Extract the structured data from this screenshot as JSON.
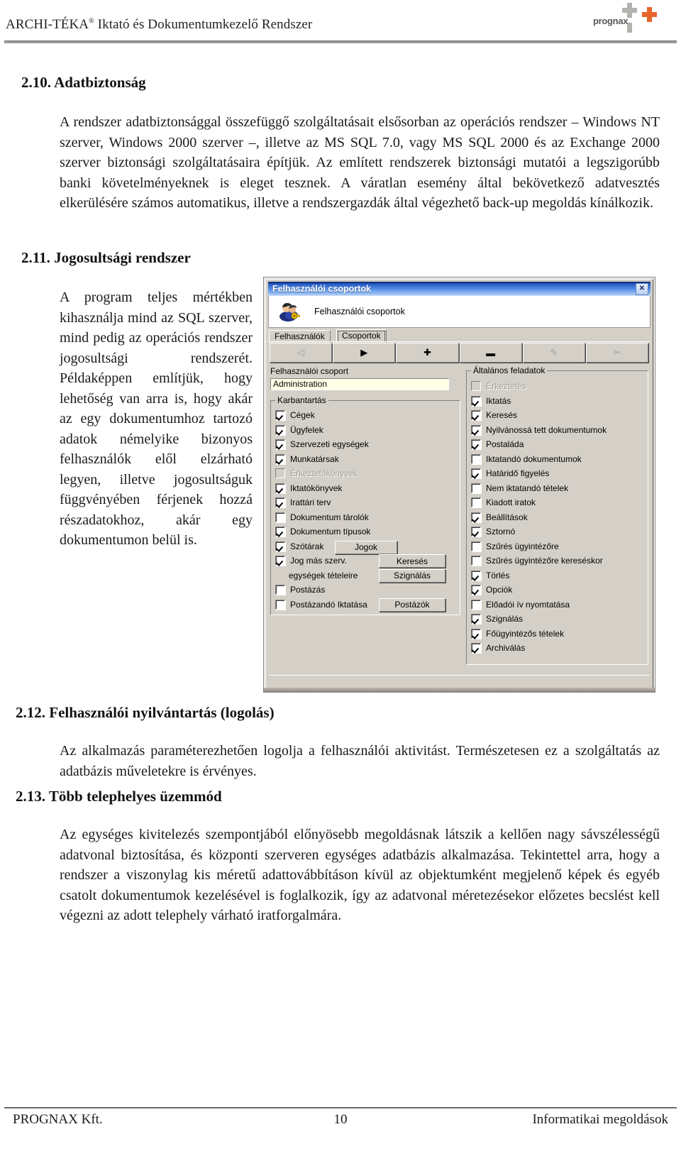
{
  "header": {
    "title_main": "ARCHI-TÉKA",
    "title_reg": "®",
    "title_rest": " Iktató és Dokumentumkezelő Rendszer",
    "logo_word": "prognax"
  },
  "sections": {
    "s210": {
      "number": "2.10.",
      "heading": "Adatbiztonság",
      "body": "A rendszer adatbiztonsággal összefüggő szolgáltatásait elsősorban az operációs rendszer – Windows NT szerver, Windows 2000 szerver –, illetve az MS SQL 7.0, vagy MS SQL 2000 és az Exchange 2000 szerver biztonsági szolgáltatásaira építjük. Az említett rendszerek biztonsági mutatói a legszigorúbb banki követelményeknek is eleget tesznek. A váratlan esemény által bekövetkező adatvesztés elkerülésére számos automatikus, illetve a rendszergazdák által végezhető back-up megoldás kínálkozik."
    },
    "s211": {
      "number": "2.11.",
      "heading": "Jogosultsági rendszer",
      "body": "A program teljes mértékben kihasználja mind az SQL szerver, mind pedig az operációs rendszer jogosultsági rendszerét. Példaképpen említjük, hogy lehetőség van arra is, hogy akár az egy dokumentumhoz tartozó adatok némelyike bizonyos felhasználók elől elzárható legyen, illetve jogosultságuk függvényében férjenek hozzá részadatokhoz, akár egy dokumentumon belül is."
    },
    "s212": {
      "number": "2.12.",
      "heading": "Felhasználói nyilvántartás (logolás)",
      "body": "Az alkalmazás paraméterezhetően logolja a felhasználói aktivitást. Természetesen ez a szolgáltatás az adatbázis műveletekre is érvényes."
    },
    "s213": {
      "number": "2.13.",
      "heading": "Több telephelyes üzemmód",
      "body": "Az egységes kivitelezés szempontjából előnyösebb megoldásnak látszik a kellően nagy sávszélességű adatvonal biztosítása, és központi szerveren egységes adatbázis alkalmazása. Tekintettel arra, hogy a rendszer a viszonylag kis méretű adattovábbításon kívül az objektumként megjelenő képek és egyéb csatolt dokumentumok kezelésével is foglalkozik, így az adatvonal méretezésekor előzetes becslést kell végezni az adott telephely várható iratforgalmára."
    }
  },
  "footer": {
    "left": "PROGNAX Kft.",
    "page_number": "10",
    "right": "Informatikai megoldások"
  },
  "dialog": {
    "title": "Felhasználói csoportok",
    "close_glyph": "✕",
    "banner_text": "Felhasználói csoportok",
    "tabs": [
      {
        "label": "Felhasználók",
        "active": false
      },
      {
        "label": "Csoportok",
        "active": true
      }
    ],
    "toolbar_buttons": [
      {
        "name": "first-record-button",
        "glyph": "◁",
        "disabled": true
      },
      {
        "name": "next-record-button",
        "glyph": "▶",
        "disabled": false
      },
      {
        "name": "add-record-button",
        "glyph": "✚",
        "disabled": false
      },
      {
        "name": "delete-record-button",
        "glyph": "▬",
        "disabled": false
      },
      {
        "name": "edit-record-button",
        "glyph": "✎",
        "disabled": true
      },
      {
        "name": "cancel-edit-button",
        "glyph": "✂",
        "disabled": true
      }
    ],
    "group_field": {
      "label": "Felhasználói csoport",
      "value": "Administration"
    },
    "left_group": {
      "title": "Karbantartás",
      "items": [
        {
          "label": "Cégek",
          "checked": true,
          "disabled": false
        },
        {
          "label": "Ügyfelek",
          "checked": true,
          "disabled": false
        },
        {
          "label": "Szervezeti egységek",
          "checked": true,
          "disabled": false
        },
        {
          "label": "Munkatársak",
          "checked": true,
          "disabled": false
        },
        {
          "label": "Érkeztetőkönyvek",
          "checked": false,
          "disabled": true
        },
        {
          "label": "Iktatókönyvek",
          "checked": true,
          "disabled": false
        },
        {
          "label": "Irattári terv",
          "checked": true,
          "disabled": false
        },
        {
          "label": "Dokumentum tárolók",
          "checked": false,
          "disabled": false
        },
        {
          "label": "Dokumentum típusok",
          "checked": true,
          "disabled": false
        },
        {
          "label": "Szótárak",
          "checked": true,
          "disabled": false
        },
        {
          "label": "Jog más szerv.",
          "checked": true,
          "disabled": false
        },
        {
          "label": "egységek tételeire",
          "checked": null,
          "disabled": false
        },
        {
          "label": "Postázás",
          "checked": false,
          "disabled": false
        },
        {
          "label": "Postázandó Iktatása",
          "checked": false,
          "disabled": false
        }
      ],
      "buttons": {
        "jogok": "Jogok",
        "kereses": "Keresés",
        "szignalas": "Szignálás",
        "postazok": "Postázók"
      }
    },
    "right_group": {
      "title": "Általános feladatok",
      "items": [
        {
          "label": "Érkeztetés",
          "checked": false,
          "disabled": true
        },
        {
          "label": "Iktatás",
          "checked": true,
          "disabled": false
        },
        {
          "label": "Keresés",
          "checked": true,
          "disabled": false
        },
        {
          "label": "Nyilvánossá tett dokumentumok",
          "checked": true,
          "disabled": false
        },
        {
          "label": "Postaláda",
          "checked": true,
          "disabled": false
        },
        {
          "label": "Iktatandó dokumentumok",
          "checked": false,
          "disabled": false
        },
        {
          "label": "Határidő figyelés",
          "checked": true,
          "disabled": false
        },
        {
          "label": "Nem iktatandó tételek",
          "checked": false,
          "disabled": false
        },
        {
          "label": "Kiadott iratok",
          "checked": false,
          "disabled": false
        },
        {
          "label": "Beállítások",
          "checked": true,
          "disabled": false
        },
        {
          "label": "Sztornó",
          "checked": true,
          "disabled": false
        },
        {
          "label": "Szűrés ügyintézőre",
          "checked": false,
          "disabled": false
        },
        {
          "label": "Szűrés ügyintézőre kereséskor",
          "checked": false,
          "disabled": false
        },
        {
          "label": "Törlés",
          "checked": true,
          "disabled": false
        },
        {
          "label": "Opciók",
          "checked": true,
          "disabled": false
        },
        {
          "label": "Előadói ív nyomtatása",
          "checked": false,
          "disabled": false
        },
        {
          "label": "Szignálás",
          "checked": true,
          "disabled": false
        },
        {
          "label": "Főügyintézős tételek",
          "checked": true,
          "disabled": false
        },
        {
          "label": "Archiválás",
          "checked": true,
          "disabled": false
        }
      ]
    }
  },
  "colors": {
    "dialog_face": "#d4d0c8",
    "titlebar_blue": "#0a246a",
    "logo_orange": "#e8642a",
    "logo_gray": "#b2b2ae",
    "field_bg": "#ffffe8"
  }
}
